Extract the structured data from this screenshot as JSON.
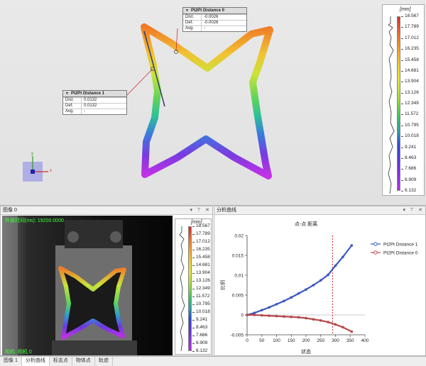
{
  "viewport": {
    "label0": {
      "title": "Pt2Pt Distance 0",
      "rows": [
        {
          "k": "Dist.",
          "v": "-0.0026"
        },
        {
          "k": "Def.",
          "v": "-0.0026"
        },
        {
          "k": "Avg.",
          "v": "-"
        }
      ]
    },
    "label1": {
      "title": "Pt2Pt Distance 1",
      "rows": [
        {
          "k": "Dist.",
          "v": "0.0132"
        },
        {
          "k": "Def.",
          "v": "0.0132"
        },
        {
          "k": "Avg.",
          "v": "-"
        }
      ]
    },
    "axis_labels": {
      "y": "y",
      "x": "x"
    },
    "colorbar": {
      "unit": "[mm]",
      "ticks": [
        "18.567",
        "17.789",
        "17.012",
        "16.235",
        "15.458",
        "14.681",
        "13.904",
        "13.126",
        "12.349",
        "11.572",
        "10.795",
        "10.018",
        "9.241",
        "8.463",
        "7.686",
        "6.909",
        "6.132"
      ]
    }
  },
  "image_panel": {
    "title": "图像 0",
    "header_buttons": [
      "▾",
      "⊤",
      "✕"
    ],
    "overlay_top": "外部时间(ms): 19200.0000",
    "overlay_bottom": "相机: 相机 0",
    "colorbar_unit": "[mm]",
    "colorbar_ticks": [
      "18.567",
      "17.789",
      "17.012",
      "16.235",
      "15.458",
      "14.681",
      "13.904",
      "13.126",
      "12.349",
      "11.572",
      "10.795",
      "10.018",
      "9.241",
      "8.463",
      "7.686",
      "6.909",
      "6.132"
    ]
  },
  "chart_panel": {
    "title": "分析曲线",
    "header_buttons": [
      "▾",
      "⊤",
      "✕"
    ]
  },
  "tabs": [
    {
      "label": "图像 1",
      "active": false
    },
    {
      "label": "分析曲线",
      "active": true
    },
    {
      "label": "标志点",
      "active": false
    },
    {
      "label": "物体点",
      "active": false
    },
    {
      "label": "轨迹",
      "active": false
    }
  ],
  "chart_data": {
    "type": "line",
    "title": "点-点 距离",
    "xlabel": "状态",
    "ylabel": "比例",
    "xlim": [
      0,
      400
    ],
    "ylim": [
      -0.005,
      0.02
    ],
    "xticks": [
      "0",
      "50",
      "100",
      "150",
      "200",
      "250",
      "300",
      "350",
      "400"
    ],
    "yticks": [
      "-0.005",
      "0",
      "0.005",
      "0.01",
      "0.015",
      "0.02"
    ],
    "current_state_marker": 290,
    "series": [
      {
        "name": "Pt2Pt Distance 1",
        "color": "#3b57c4",
        "x": [
          0,
          25,
          50,
          75,
          100,
          125,
          150,
          175,
          200,
          225,
          250,
          275,
          300,
          325,
          355
        ],
        "y": [
          0,
          0.0005,
          0.0012,
          0.0019,
          0.0027,
          0.0035,
          0.0044,
          0.0054,
          0.0064,
          0.0075,
          0.0087,
          0.0101,
          0.0124,
          0.0146,
          0.0175
        ]
      },
      {
        "name": "Pt2Pt Distance 0",
        "color": "#b5484a",
        "x": [
          0,
          25,
          50,
          75,
          100,
          125,
          150,
          175,
          200,
          225,
          250,
          275,
          300,
          325,
          355
        ],
        "y": [
          0,
          0,
          -0.0001,
          -0.0002,
          -0.0003,
          -0.0004,
          -0.0005,
          -0.0006,
          -0.0008,
          -0.0011,
          -0.0014,
          -0.0018,
          -0.0024,
          -0.0031,
          -0.0042
        ]
      }
    ]
  }
}
